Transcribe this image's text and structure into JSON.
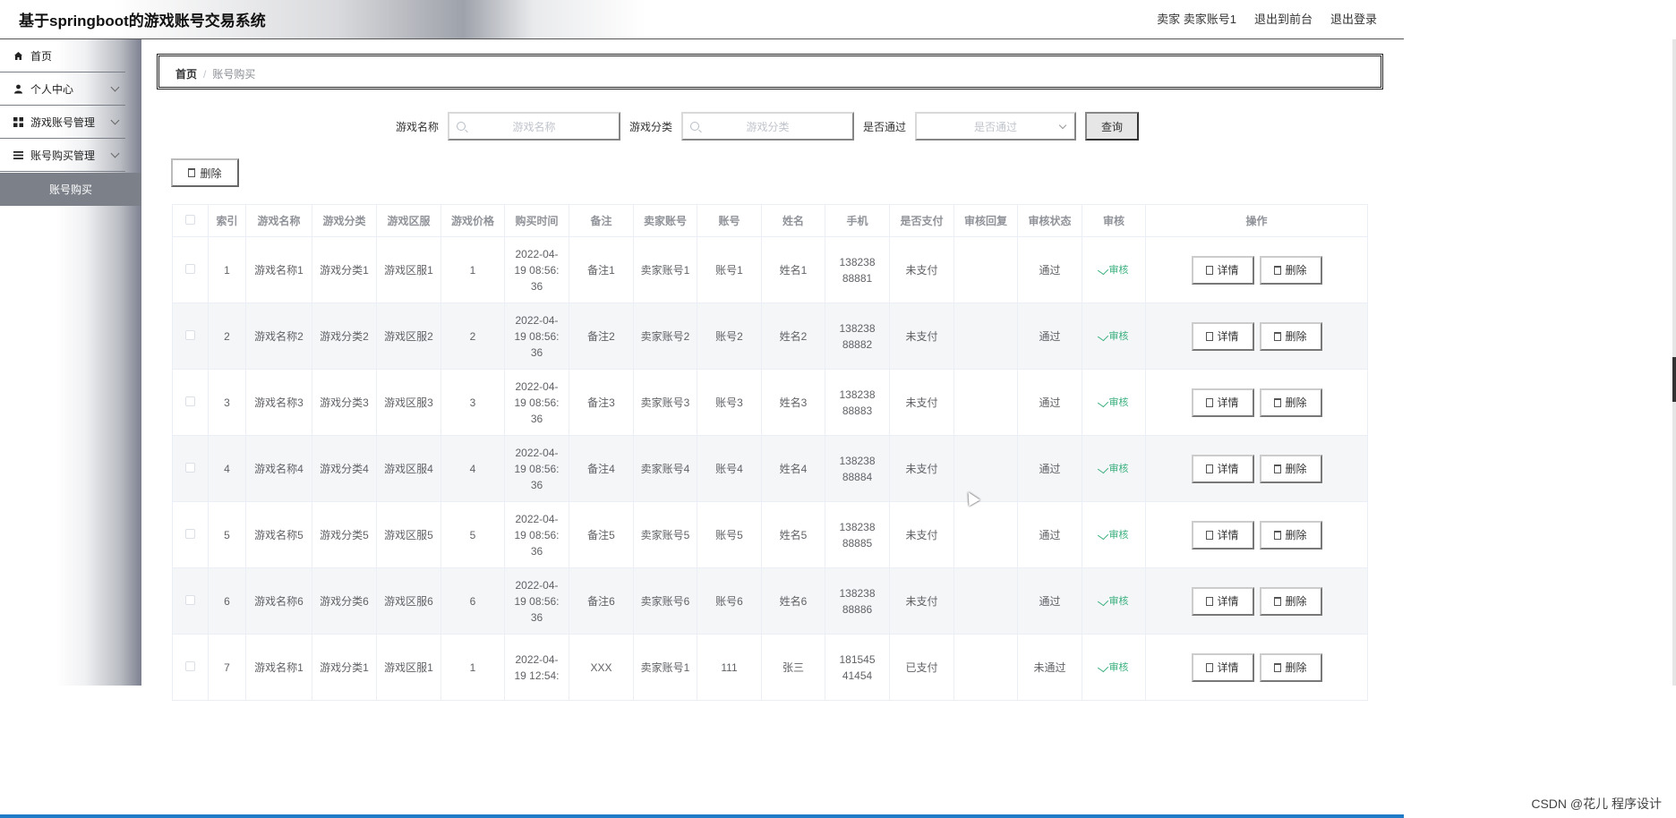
{
  "header": {
    "title": "基于springboot的游戏账号交易系统",
    "user": "卖家 卖家账号1",
    "front_link": "退出到前台",
    "logout": "退出登录"
  },
  "sidebar": {
    "items": [
      {
        "label": "首页",
        "icon": "home-icon"
      },
      {
        "label": "个人中心",
        "icon": "user-icon"
      },
      {
        "label": "游戏账号管理",
        "icon": "grid-icon"
      },
      {
        "label": "账号购买管理",
        "icon": "list-icon"
      }
    ],
    "active_sub": "账号购买"
  },
  "breadcrumb": {
    "home": "首页",
    "sep": "/",
    "current": "账号购买"
  },
  "search": {
    "name_label": "游戏名称",
    "name_placeholder": "游戏名称",
    "cat_label": "游戏分类",
    "cat_placeholder": "游戏分类",
    "pass_label": "是否通过",
    "pass_placeholder": "是否通过",
    "query": "查询"
  },
  "toolbar": {
    "delete": "删除"
  },
  "table": {
    "headers": [
      "",
      "索引",
      "游戏名称",
      "游戏分类",
      "游戏区服",
      "游戏价格",
      "购买时间",
      "备注",
      "卖家账号",
      "账号",
      "姓名",
      "手机",
      "是否支付",
      "审核回复",
      "审核状态",
      "审核",
      "操作"
    ],
    "audit_label": "审核",
    "detail_label": "详情",
    "delete_label": "删除",
    "rows": [
      {
        "idx": "1",
        "name": "游戏名称1",
        "cat": "游戏分类1",
        "server": "游戏区服1",
        "price": "1",
        "time": "2022-04-19 08:56:36",
        "note": "备注1",
        "seller": "卖家账号1",
        "account": "账号1",
        "person": "姓名1",
        "phone": "13823888881",
        "paid": "未支付",
        "reply": "",
        "status": "通过"
      },
      {
        "idx": "2",
        "name": "游戏名称2",
        "cat": "游戏分类2",
        "server": "游戏区服2",
        "price": "2",
        "time": "2022-04-19 08:56:36",
        "note": "备注2",
        "seller": "卖家账号2",
        "account": "账号2",
        "person": "姓名2",
        "phone": "13823888882",
        "paid": "未支付",
        "reply": "",
        "status": "通过"
      },
      {
        "idx": "3",
        "name": "游戏名称3",
        "cat": "游戏分类3",
        "server": "游戏区服3",
        "price": "3",
        "time": "2022-04-19 08:56:36",
        "note": "备注3",
        "seller": "卖家账号3",
        "account": "账号3",
        "person": "姓名3",
        "phone": "13823888883",
        "paid": "未支付",
        "reply": "",
        "status": "通过"
      },
      {
        "idx": "4",
        "name": "游戏名称4",
        "cat": "游戏分类4",
        "server": "游戏区服4",
        "price": "4",
        "time": "2022-04-19 08:56:36",
        "note": "备注4",
        "seller": "卖家账号4",
        "account": "账号4",
        "person": "姓名4",
        "phone": "13823888884",
        "paid": "未支付",
        "reply": "",
        "status": "通过"
      },
      {
        "idx": "5",
        "name": "游戏名称5",
        "cat": "游戏分类5",
        "server": "游戏区服5",
        "price": "5",
        "time": "2022-04-19 08:56:36",
        "note": "备注5",
        "seller": "卖家账号5",
        "account": "账号5",
        "person": "姓名5",
        "phone": "13823888885",
        "paid": "未支付",
        "reply": "",
        "status": "通过"
      },
      {
        "idx": "6",
        "name": "游戏名称6",
        "cat": "游戏分类6",
        "server": "游戏区服6",
        "price": "6",
        "time": "2022-04-19 08:56:36",
        "note": "备注6",
        "seller": "卖家账号6",
        "account": "账号6",
        "person": "姓名6",
        "phone": "13823888886",
        "paid": "未支付",
        "reply": "",
        "status": "通过"
      },
      {
        "idx": "7",
        "name": "游戏名称1",
        "cat": "游戏分类1",
        "server": "游戏区服1",
        "price": "1",
        "time": "2022-04-19 12:54:",
        "note": "XXX",
        "seller": "卖家账号1",
        "account": "111",
        "person": "张三",
        "phone": "18154541454",
        "paid": "已支付",
        "reply": "",
        "status": "未通过"
      }
    ]
  },
  "watermark": "CSDN @花儿  程序设计"
}
